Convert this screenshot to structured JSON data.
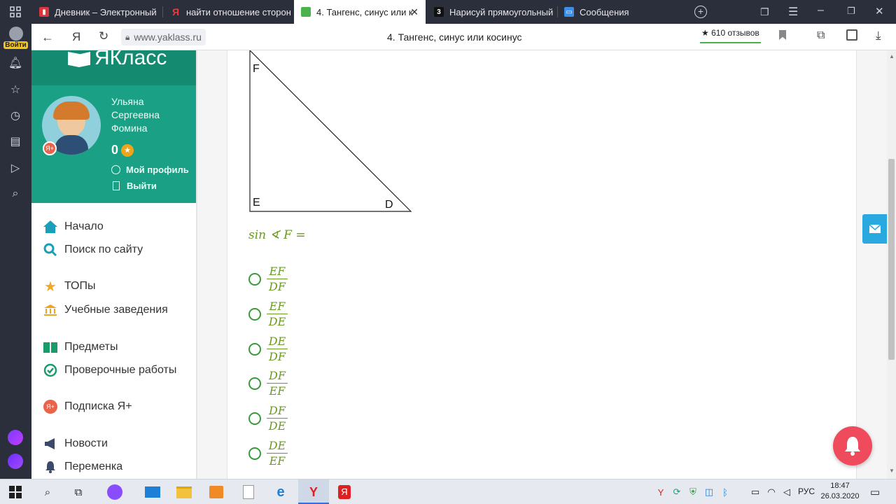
{
  "browser": {
    "tabs": [
      {
        "label": "Дневник – Электронный",
        "icon": "diary-icon"
      },
      {
        "label": "найти отношение сторон",
        "icon": "yandex-icon"
      },
      {
        "label": "4. Тангенс, синус или к",
        "icon": "yaklass-icon"
      },
      {
        "label": "Нарисуй прямоугольный",
        "icon": "znanija-icon"
      },
      {
        "label": "Сообщения",
        "icon": "messages-icon"
      }
    ],
    "login_label": "Войти",
    "address": "www.yaklass.ru",
    "page_title": "4. Тангенс, синус или косинус",
    "reviews": "★ 610 отзывов"
  },
  "site": {
    "logo": "ЯКласс",
    "user": {
      "name_line1": "Ульяна",
      "name_line2": "Сергеевна",
      "name_line3": "Фомина",
      "points": "0",
      "profile_link": "Мой профиль",
      "logout_link": "Выйти"
    },
    "nav": [
      {
        "label": "Начало",
        "icon": "home-icon"
      },
      {
        "label": "Поиск по сайту",
        "icon": "search-icon"
      },
      {
        "label": "ТОПы",
        "icon": "star-icon"
      },
      {
        "label": "Учебные заведения",
        "icon": "school-icon"
      },
      {
        "label": "Предметы",
        "icon": "book-icon"
      },
      {
        "label": "Проверочные работы",
        "icon": "check-icon"
      },
      {
        "label": "Подписка Я+",
        "icon": "plus-icon"
      },
      {
        "label": "Новости",
        "icon": "megaphone-icon"
      },
      {
        "label": "Переменка",
        "icon": "bell-icon"
      }
    ]
  },
  "task": {
    "vertices": {
      "top": "F",
      "bottom_left": "E",
      "bottom_right": "D"
    },
    "question": "sin ∢ F =",
    "options": [
      {
        "num": "EF",
        "den": "DF"
      },
      {
        "num": "EF",
        "den": "DE"
      },
      {
        "num": "DE",
        "den": "DF"
      },
      {
        "num": "DF",
        "den": "EF"
      },
      {
        "num": "DF",
        "den": "DE"
      },
      {
        "num": "DE",
        "den": "EF"
      }
    ]
  },
  "taskbar": {
    "lang": "РУС",
    "time": "18:47",
    "date": "26.03.2020"
  }
}
